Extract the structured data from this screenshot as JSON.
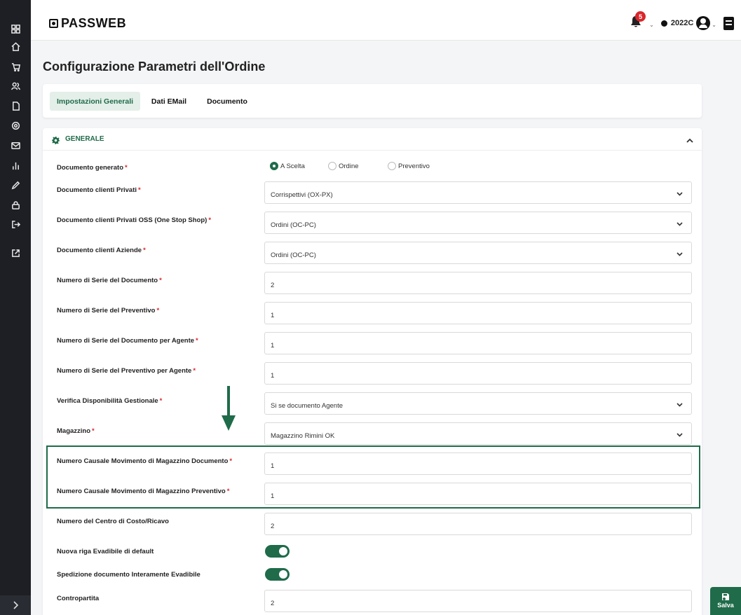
{
  "app": {
    "logo_text": "PASSWEB"
  },
  "header": {
    "notifications_count": "5",
    "year": "2022C"
  },
  "page": {
    "title": "Configurazione Parametri dell'Ordine"
  },
  "tabs": [
    {
      "label": "Impostazioni Generali",
      "active": true
    },
    {
      "label": "Dati EMail",
      "active": false
    },
    {
      "label": "Documento",
      "active": false
    }
  ],
  "section": {
    "title": "GENERALE"
  },
  "sidebar_icons": [
    "dashboard-icon",
    "home-icon",
    "cart-icon",
    "users-icon",
    "document-icon",
    "settings-icon",
    "mail-icon",
    "chart-icon",
    "pencil-icon",
    "lock-icon",
    "logout-icon",
    "external-link-icon"
  ],
  "fields": {
    "documento_generato": {
      "label": "Documento generato",
      "options": [
        "A Scelta",
        "Ordine",
        "Preventivo"
      ],
      "selected": "A Scelta"
    },
    "doc_privati": {
      "label": "Documento clienti Privati",
      "value": "Corrispettivi (OX-PX)"
    },
    "doc_privati_oss": {
      "label": "Documento clienti Privati OSS (One Stop Shop)",
      "value": "Ordini (OC-PC)"
    },
    "doc_aziende": {
      "label": "Documento clienti Aziende",
      "value": "Ordini (OC-PC)"
    },
    "serie_documento": {
      "label": "Numero di Serie del Documento",
      "value": "2"
    },
    "serie_preventivo": {
      "label": "Numero di Serie del Preventivo",
      "value": "1"
    },
    "serie_doc_agente": {
      "label": "Numero di Serie del Documento per Agente",
      "value": "1"
    },
    "serie_prev_agente": {
      "label": "Numero di Serie del Preventivo per Agente",
      "value": "1"
    },
    "verifica_disp": {
      "label": "Verifica Disponibilità Gestionale",
      "value": "Si se documento Agente"
    },
    "magazzino": {
      "label": "Magazzino",
      "value": "Magazzino Rimini OK"
    },
    "causale_documento": {
      "label": "Numero Causale Movimento di Magazzino Documento",
      "value": "1"
    },
    "causale_preventivo": {
      "label": "Numero Causale Movimento di Magazzino Preventivo",
      "value": "1"
    },
    "centro_costo": {
      "label": "Numero del Centro di Costo/Ricavo",
      "value": "2"
    },
    "nuova_riga": {
      "label": "Nuova riga Evadibile di default",
      "on": true
    },
    "spedizione": {
      "label": "Spedizione documento Interamente Evadibile",
      "on": true
    },
    "contropartita": {
      "label": "Contropartita",
      "value": "2"
    }
  },
  "required_marker": "*",
  "save_button": {
    "label": "Salva"
  },
  "colors": {
    "accent": "#1f6b4a",
    "required": "#d9262c",
    "sidebar": "#1e1f24"
  }
}
